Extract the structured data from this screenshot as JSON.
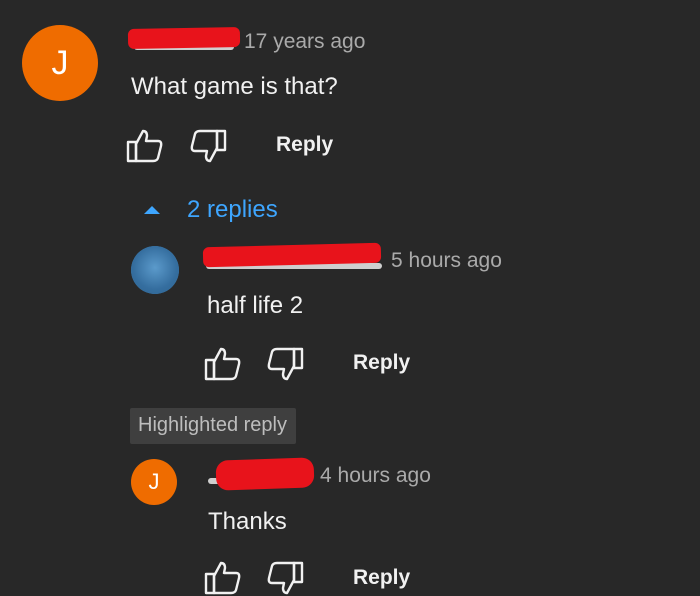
{
  "comment_main": {
    "avatar_letter": "J",
    "time": "17 years ago",
    "text": "What game is that?",
    "reply_label": "Reply"
  },
  "replies_toggle": {
    "label": "2 replies"
  },
  "reply_1": {
    "time": "5 hours ago",
    "text": "half life 2",
    "reply_label": "Reply"
  },
  "highlighted": {
    "badge": "Highlighted reply"
  },
  "reply_2": {
    "avatar_letter": "J",
    "time": "4 hours ago",
    "text": "Thanks",
    "reply_label": "Reply"
  },
  "colors": {
    "background": "#282828",
    "avatar_orange": "#ef6c00",
    "link_blue": "#3ea6ff",
    "redaction_red": "#e8131b"
  }
}
